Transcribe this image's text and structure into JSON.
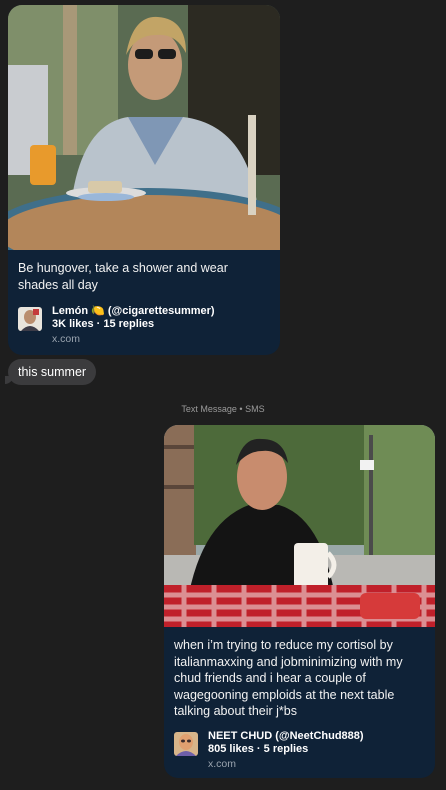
{
  "messages": [
    {
      "type": "link-preview",
      "text": "Be hungover, take a shower and wear shades all day",
      "author": "Lemón 🍋 (@cigarettesummer)",
      "stats": "3K likes · 15 replies",
      "domain": "x.com",
      "image_icon": "man-in-sunglasses-photo"
    },
    {
      "type": "text-bubble",
      "text": "this summer"
    }
  ],
  "timestamp": "Text Message • SMS",
  "reply": {
    "type": "link-preview",
    "text": "when i’m trying to reduce my cortisol by italianmaxxing and jobminimizing with my chud friends and i hear a couple of wagegooning emploids at the next table talking about their j*bs",
    "author": "NEET CHUD (@NeetChud888)",
    "stats": "805 likes · 5 replies",
    "domain": "x.com",
    "image_icon": "man-at-outdoor-cafe-photo"
  }
}
